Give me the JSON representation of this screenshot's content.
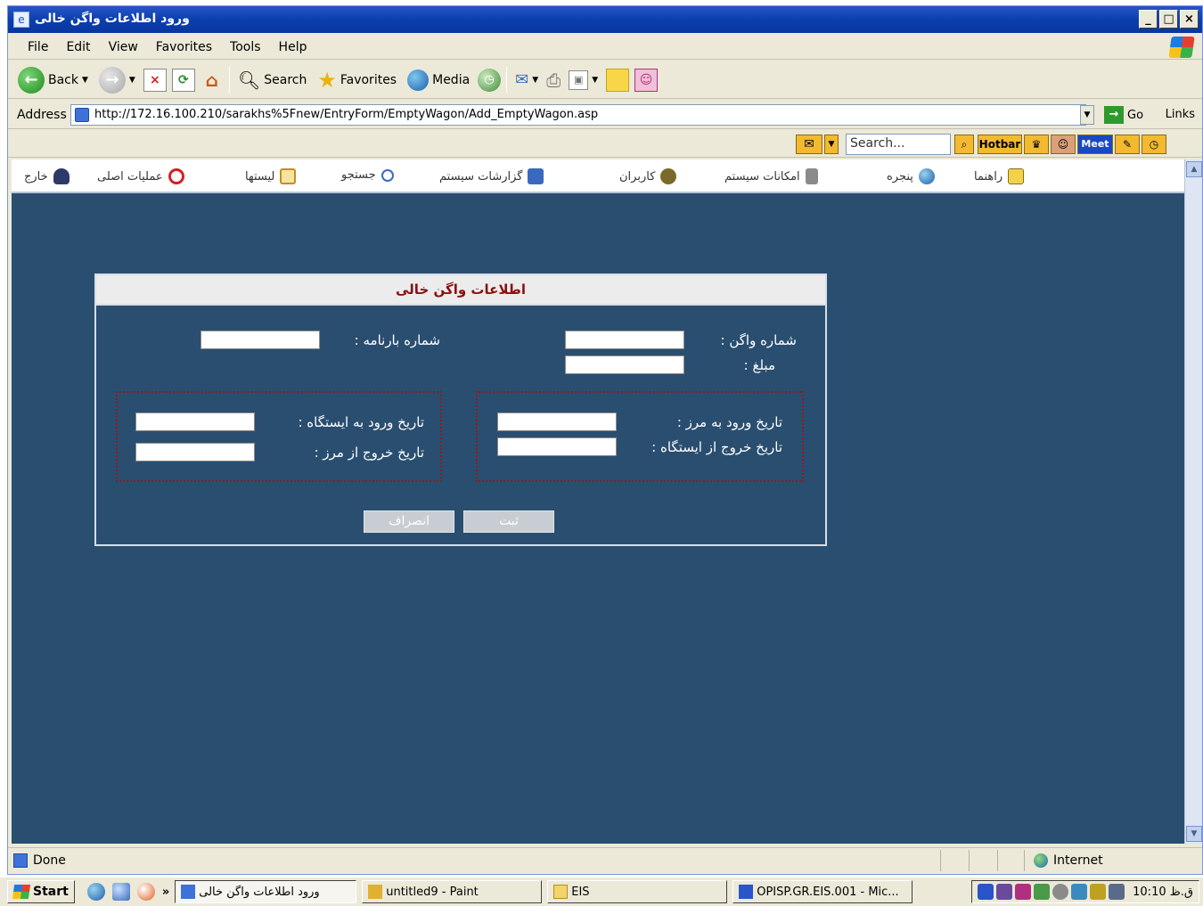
{
  "window": {
    "title": "ورود اطلاعات واگن خالی",
    "controls": [
      "_",
      "□",
      "×"
    ]
  },
  "menubar": [
    "File",
    "Edit",
    "View",
    "Favorites",
    "Tools",
    "Help"
  ],
  "toolbar": {
    "back": "Back",
    "search": "Search",
    "favorites": "Favorites",
    "media": "Media"
  },
  "address": {
    "label": "Address",
    "url": "http://172.16.100.210/sarakhs%5Fnew/EntryForm/EmptyWagon/Add_EmptyWagon.asp",
    "go": "Go",
    "links": "Links"
  },
  "hotbar": {
    "search_placeholder": "Search...",
    "hotbar_label": "Hotbar",
    "meet_label": "Meet"
  },
  "app_menu": [
    {
      "label": "خارج",
      "icon": "exit-icon"
    },
    {
      "label": "عملیات اصلی",
      "icon": "gear-icon"
    },
    {
      "label": "لیستها",
      "icon": "list-icon"
    },
    {
      "label": "جستجو",
      "icon": "search-icon"
    },
    {
      "label": "گزارشات سیستم",
      "icon": "report-icon"
    },
    {
      "label": "کاربران",
      "icon": "users-icon"
    },
    {
      "label": "امکانات سیستم",
      "icon": "tools-icon"
    },
    {
      "label": "پنجره",
      "icon": "window-icon"
    },
    {
      "label": "راهنما",
      "icon": "help-icon"
    }
  ],
  "form": {
    "title": "اطلاعات واگن خالی",
    "wagon_number_label": "شماره واگن :",
    "amount_label": "مبلغ :",
    "bill_number_label": "شماره بارنامه :",
    "border_entry_label": "تاریخ ورود به مرز :",
    "station_exit_label": "تاریخ خروج از ایستگاه :",
    "station_entry_label": "تاریخ ورود به ایستگاه :",
    "border_exit_label": "تاریخ خروج از مرز :",
    "submit_label": "ثبت",
    "cancel_label": "انصراف"
  },
  "status": {
    "text": "Done",
    "zone": "Internet"
  },
  "taskbar": {
    "start": "Start",
    "chevron": "»",
    "tasks": [
      {
        "label": "ورود اطلاعات واگن خالی",
        "active": true
      },
      {
        "label": "untitled9 - Paint",
        "active": false
      },
      {
        "label": "EIS",
        "active": false
      },
      {
        "label": "OPISP.GR.EIS.001 - Mic...",
        "active": false
      }
    ],
    "clock": "10:10 ق.ظ"
  }
}
